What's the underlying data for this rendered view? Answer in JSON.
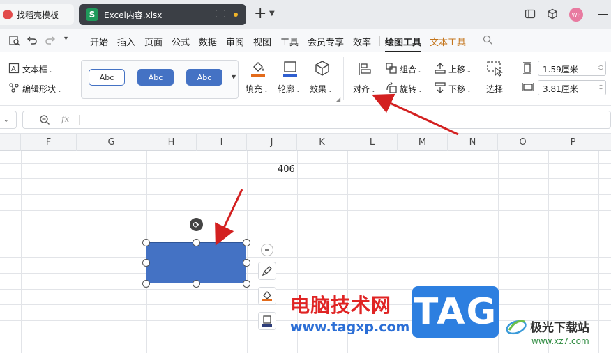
{
  "tabs": {
    "inactive_label": "找稻壳模板",
    "active_label": "Excel内容.xlsx",
    "file_badge": "S"
  },
  "window": {
    "avatar_text": "WP"
  },
  "menu": {
    "items": [
      "开始",
      "插入",
      "页面",
      "公式",
      "数据",
      "审阅",
      "视图",
      "工具",
      "会员专享",
      "效率",
      "绘图工具",
      "文本工具"
    ],
    "active_index": 10,
    "context_index": 11
  },
  "ribbon": {
    "textbox_label": "文本框",
    "edit_shape_label": "编辑形状",
    "styles": [
      "Abc",
      "Abc",
      "Abc"
    ],
    "fill_label": "填充",
    "outline_label": "轮廓",
    "effect_label": "效果",
    "align_label": "对齐",
    "group_label": "组合",
    "rotate_label": "旋转",
    "bring_forward_label": "上移",
    "send_backward_label": "下移",
    "select_label": "选择",
    "height_value": "1.59厘米",
    "width_value": "3.81厘米"
  },
  "formula_bar": {
    "fx_label": "fx",
    "value": ""
  },
  "grid": {
    "columns": [
      "F",
      "G",
      "H",
      "I",
      "J",
      "K",
      "L",
      "M",
      "N",
      "O",
      "P"
    ],
    "cell_value": "406"
  },
  "watermark": {
    "site_name": "电脑技术网",
    "site_url": "www.tagxp.com",
    "tag": "TAG",
    "jg_name": "极光下载站",
    "jg_url": "www.xz7.com"
  },
  "colors": {
    "shape_fill": "#4472c4",
    "arrow": "#d32020",
    "accent_context": "#c4751b"
  }
}
